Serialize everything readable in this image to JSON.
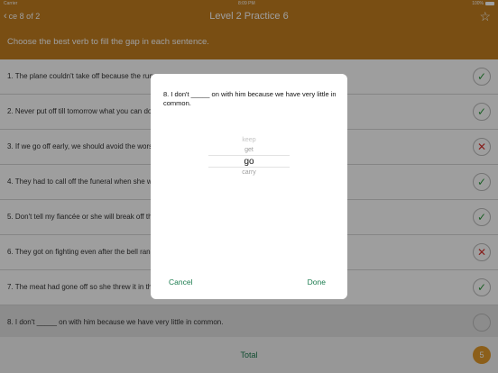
{
  "status": {
    "carrier": "Carrier",
    "time": "8:09 PM",
    "battery": "100%"
  },
  "nav": {
    "back_label": "ce 8 of 2",
    "title": "Level 2 Practice 6",
    "star_icon": "star-outline-icon"
  },
  "instruction": "Choose the best verb to fill the gap in each sentence.",
  "rows": [
    {
      "text": "1. The plane couldn't take off because the runw",
      "status": "correct",
      "symbol": "✓"
    },
    {
      "text": "2. Never put off till tomorrow what you can do t",
      "status": "correct",
      "symbol": "✓"
    },
    {
      "text": "3. If we go off early, we should avoid the worst",
      "status": "wrong",
      "symbol": "✕"
    },
    {
      "text": "4. They had to call off the funeral when she wo",
      "status": "correct",
      "symbol": "✓"
    },
    {
      "text": "5. Don't tell my fiancée or she will break off the",
      "status": "correct",
      "symbol": "✓"
    },
    {
      "text": "6. They got on fighting even after the bell rang.",
      "status": "wrong",
      "symbol": "✕"
    },
    {
      "text": "7. The meat had gone off so she threw it in the",
      "status": "correct",
      "symbol": "✓"
    },
    {
      "text": "8. I don't _____ on with him because we have very little in common.",
      "status": "empty",
      "symbol": ""
    }
  ],
  "total": {
    "label": "Total",
    "score": "5"
  },
  "modal": {
    "question": "8. I don't _____ on with him because we have very little in common.",
    "picker": {
      "above2": "keep",
      "above1": "get",
      "selected": "go",
      "below1": "carry"
    },
    "cancel": "Cancel",
    "done": "Done"
  },
  "colors": {
    "accent": "#c37e1f",
    "button": "#1a7b4e",
    "correct": "#2e9b3e",
    "wrong": "#d9312c",
    "score": "#e29a2b"
  }
}
